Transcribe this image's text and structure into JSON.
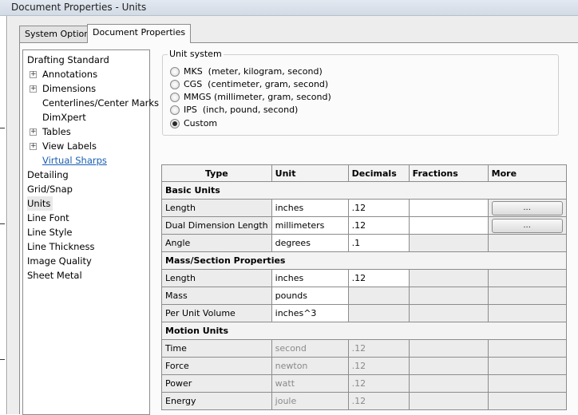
{
  "window": {
    "title": "Document Properties - Units"
  },
  "tabs": [
    {
      "label": "System Options",
      "active": false
    },
    {
      "label": "Document Properties",
      "active": true
    }
  ],
  "tree": {
    "items": [
      {
        "label": "Drafting Standard"
      },
      {
        "label": "Annotations"
      },
      {
        "label": "Dimensions"
      },
      {
        "label": "Centerlines/Center Marks"
      },
      {
        "label": "DimXpert"
      },
      {
        "label": "Tables"
      },
      {
        "label": "View Labels"
      },
      {
        "label": "Virtual Sharps"
      },
      {
        "label": "Detailing"
      },
      {
        "label": "Grid/Snap"
      },
      {
        "label": "Units",
        "selected": true
      },
      {
        "label": "Line Font"
      },
      {
        "label": "Line Style"
      },
      {
        "label": "Line Thickness"
      },
      {
        "label": "Image Quality"
      },
      {
        "label": "Sheet Metal"
      }
    ]
  },
  "unit_system": {
    "legend": "Unit system",
    "options": [
      {
        "label": "MKS  (meter, kilogram, second)",
        "selected": false
      },
      {
        "label": "CGS  (centimeter, gram, second)",
        "selected": false
      },
      {
        "label": "MMGS (millimeter, gram, second)",
        "selected": false
      },
      {
        "label": "IPS  (inch, pound, second)",
        "selected": false
      },
      {
        "label": "Custom",
        "selected": true
      }
    ]
  },
  "table": {
    "headers": {
      "type": "Type",
      "unit": "Unit",
      "decimals": "Decimals",
      "fractions": "Fractions",
      "more": "More"
    },
    "more_button": "...",
    "sections": {
      "basic": "Basic Units",
      "mass": "Mass/Section Properties",
      "motion": "Motion Units"
    },
    "basic_rows": [
      {
        "type": "Length",
        "unit": "inches",
        "decimals": ".12"
      },
      {
        "type": "Dual Dimension Length",
        "unit": "millimeters",
        "decimals": ".12"
      },
      {
        "type": "Angle",
        "unit": "degrees",
        "decimals": ".1"
      }
    ],
    "mass_rows": [
      {
        "type": "Length",
        "unit": "inches",
        "decimals": ".12"
      },
      {
        "type": "Mass",
        "unit": "pounds"
      },
      {
        "type": "Per Unit Volume",
        "unit": "inches^3"
      }
    ],
    "motion_rows": [
      {
        "type": "Time",
        "unit": "second",
        "decimals": ".12"
      },
      {
        "type": "Force",
        "unit": "newton",
        "decimals": ".12"
      },
      {
        "type": "Power",
        "unit": "watt",
        "decimals": ".12"
      },
      {
        "type": "Energy",
        "unit": "joule",
        "decimals": ".12"
      }
    ]
  }
}
